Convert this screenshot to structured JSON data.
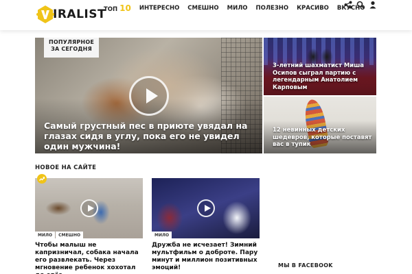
{
  "brand": {
    "name": "IRALIST",
    "accent_color": "#f0c419"
  },
  "nav": {
    "top_label": "ТОП",
    "top_number": "10",
    "items": [
      "ИНТЕРЕСНО",
      "СМЕШНО",
      "МИЛО",
      "ПОЛЕЗНО",
      "КРАСИВО",
      "ВКУСНО"
    ]
  },
  "header_icons": [
    "share-icon",
    "search-icon",
    "user-icon"
  ],
  "hero": {
    "badge_line1": "ПОПУЛЯРНОЕ",
    "badge_line2": "ЗА СЕГОДНЯ",
    "title": "Самый грустный пес в приюте увядал на глазах сидя в углу, пока его не увидел один мужчина!"
  },
  "side_cards": [
    {
      "title": "3-летний шахматист Миша Осипов сыграл партию с легендарным Анатолием Карповым"
    },
    {
      "title": "12 невинных детских шедевров, которые поставят вас в тупик"
    }
  ],
  "new_section": {
    "title": "НОВОЕ НА САЙТЕ",
    "cards": [
      {
        "tags": [
          "МИЛО",
          "СМЕШНО"
        ],
        "title": "Чтобы малыш не капризничал, собака начала его развлекать. Через мгновение ребенок хохотал до слёз"
      },
      {
        "tags": [
          "МИЛО"
        ],
        "title": "Дружба не исчезает! Зимний мультфильм о доброте. Пару минут и миллион позитивных эмоций!"
      }
    ]
  },
  "facebook": {
    "title": "МЫ В FACEBOOK"
  }
}
